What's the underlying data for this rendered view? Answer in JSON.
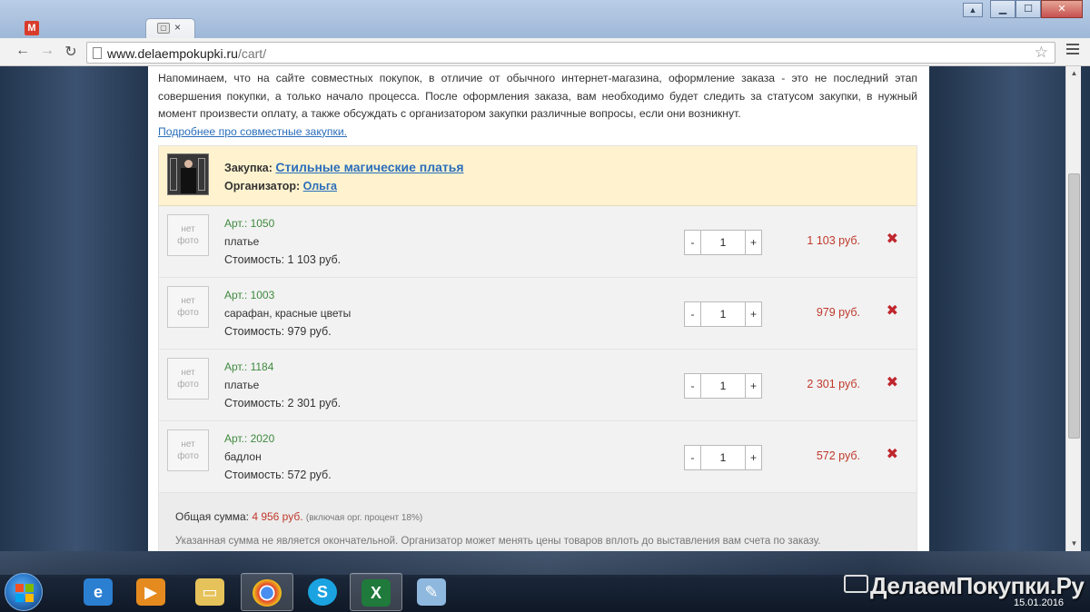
{
  "browser": {
    "tab_title": "",
    "tab_close": "×",
    "url_host": "www.delaempokupki.ru",
    "url_path": "/cart/",
    "window_controls": {
      "minimize": "▁",
      "maximize": "☐",
      "close": "✕"
    }
  },
  "intro": {
    "text": "Напоминаем, что на сайте совместных покупок, в отличие от обычного интернет-магазина, оформление заказа - это не последний этап совершения покупки, а только начало процесса. После оформления заказа, вам необходимо будет следить за статусом закупки, в нужный момент произвести оплату, а также обсуждать с организатором закупки различные вопросы, если они возникнут.",
    "more_link": "Подробнее про совместные закупки."
  },
  "purchase": {
    "purchase_label": "Закупка:",
    "purchase_name": "Стильные магические платья",
    "organizer_label": "Организатор:",
    "organizer_name": "Ольга"
  },
  "items": [
    {
      "art": "Арт.: 1050",
      "name": "платье",
      "cost": "Стоимость: 1 103 руб.",
      "qty": "1",
      "price": "1 103 руб.",
      "no_photo": "нет\nфото"
    },
    {
      "art": "Арт.: 1003",
      "name": "сарафан, красные цветы",
      "cost": "Стоимость: 979 руб.",
      "qty": "1",
      "price": "979 руб.",
      "no_photo": "нет\nфото"
    },
    {
      "art": "Арт.: 1184",
      "name": "платье",
      "cost": "Стоимость: 2 301 руб.",
      "qty": "1",
      "price": "2 301 руб.",
      "no_photo": "нет\nфото"
    },
    {
      "art": "Арт.: 2020",
      "name": "бадлон",
      "cost": "Стоимость: 572 руб.",
      "qty": "1",
      "price": "572 руб.",
      "no_photo": "нет\nфото"
    }
  ],
  "controls": {
    "minus": "-",
    "plus": "+",
    "remove": "✖"
  },
  "summary": {
    "total_label": "Общая сумма:",
    "total_value": "4 956 руб.",
    "total_note": "(включая орг. процент 18%)",
    "disclaimer": "Указанная сумма не является окончательной. Организатор может менять цены товаров вплоть до выставления вам счета по заказу."
  },
  "taskbar": {
    "brand": "ДелаемПокупки.Ру",
    "date": "15.01.2016"
  }
}
